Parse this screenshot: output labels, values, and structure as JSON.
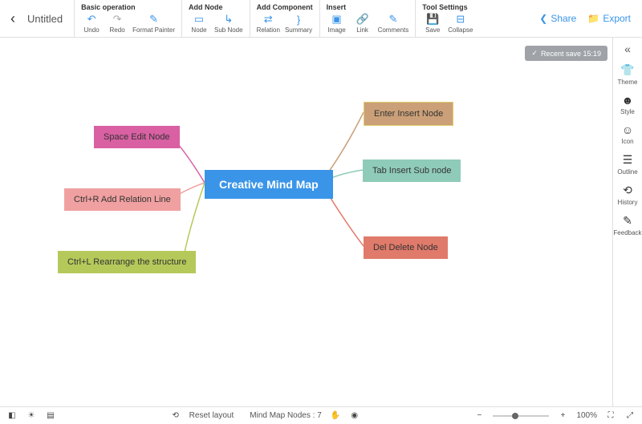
{
  "title": "Untitled",
  "toolbar": {
    "groups": [
      {
        "title": "Basic operation",
        "items": [
          {
            "name": "undo",
            "label": "Undo",
            "glyph": "↶"
          },
          {
            "name": "redo",
            "label": "Redo",
            "glyph": "↷",
            "grey": true
          },
          {
            "name": "format-painter",
            "label": "Format Painter",
            "glyph": "✎"
          }
        ]
      },
      {
        "title": "Add Node",
        "items": [
          {
            "name": "node",
            "label": "Node",
            "glyph": "▭"
          },
          {
            "name": "sub-node",
            "label": "Sub Node",
            "glyph": "↳"
          }
        ]
      },
      {
        "title": "Add Component",
        "items": [
          {
            "name": "relation",
            "label": "Relation",
            "glyph": "⇄"
          },
          {
            "name": "summary",
            "label": "Summary",
            "glyph": "}"
          }
        ]
      },
      {
        "title": "Insert",
        "items": [
          {
            "name": "image",
            "label": "Image",
            "glyph": "▣"
          },
          {
            "name": "link",
            "label": "Link",
            "glyph": "🔗"
          },
          {
            "name": "comments",
            "label": "Comments",
            "glyph": "✎"
          }
        ]
      },
      {
        "title": "Tool Settings",
        "items": [
          {
            "name": "save",
            "label": "Save",
            "glyph": "💾",
            "grey": true
          },
          {
            "name": "collapse",
            "label": "Collapse",
            "glyph": "⊟"
          }
        ]
      }
    ],
    "actions": {
      "share": "Share",
      "export": "Export"
    }
  },
  "save_badge": "Recent save 15:19",
  "mindmap": {
    "center": "Creative Mind Map",
    "right": [
      {
        "label": "Enter Insert Node",
        "cls": "n-insert"
      },
      {
        "label": "Tab Insert Sub node",
        "cls": "n-sub"
      },
      {
        "label": "Del Delete Node",
        "cls": "n-del"
      }
    ],
    "left": [
      {
        "label": "Space Edit Node",
        "cls": "n-space"
      },
      {
        "label": "Ctrl+R Add Relation Line",
        "cls": "n-rel"
      },
      {
        "label": "Ctrl+L Rearrange the structure",
        "cls": "n-rearr"
      }
    ]
  },
  "rpanel": [
    {
      "name": "theme",
      "label": "Theme",
      "glyph": "👕"
    },
    {
      "name": "style",
      "label": "Style",
      "glyph": "☻"
    },
    {
      "name": "icon",
      "label": "Icon",
      "glyph": "☺"
    },
    {
      "name": "outline",
      "label": "Outline",
      "glyph": "☰"
    },
    {
      "name": "history",
      "label": "History",
      "glyph": "⟲"
    },
    {
      "name": "feedback",
      "label": "Feedback",
      "glyph": "✎"
    }
  ],
  "bottom": {
    "reset": "Reset layout",
    "nodes_label": "Mind Map Nodes :",
    "nodes_count": "7",
    "zoom": "100%"
  }
}
